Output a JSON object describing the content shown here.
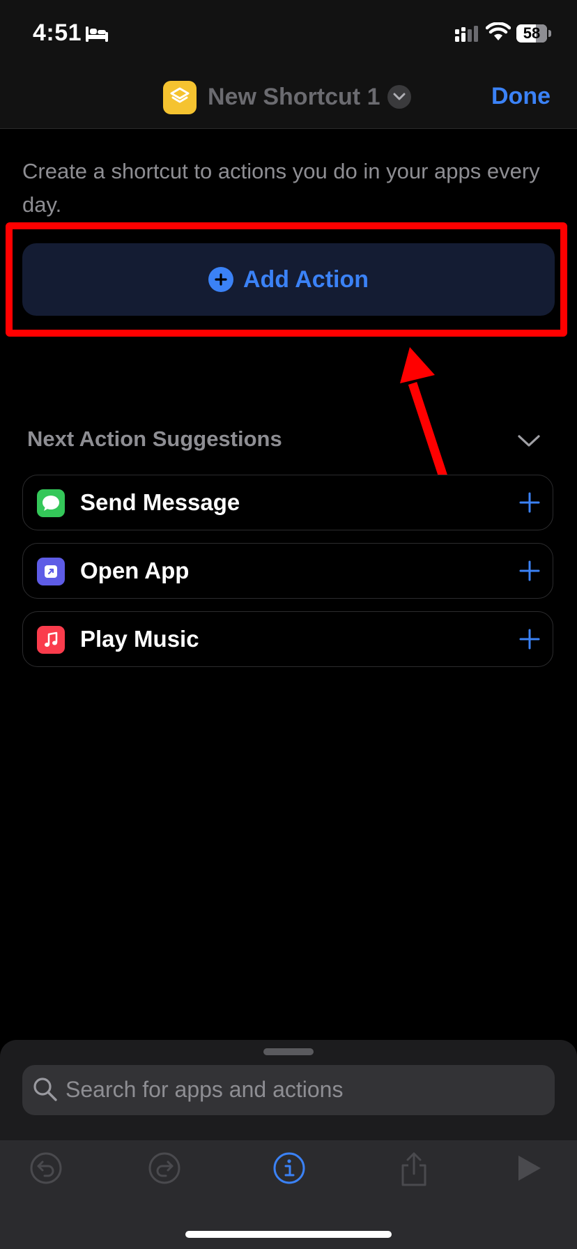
{
  "status": {
    "time": "4:51",
    "battery": "58"
  },
  "header": {
    "shortcut_name": "New Shortcut 1",
    "done_label": "Done"
  },
  "intro": "Create a shortcut to actions you do in your apps every day.",
  "add_action": {
    "label": "Add Action"
  },
  "suggestions": {
    "title": "Next Action Suggestions",
    "items": [
      {
        "label": "Send Message",
        "icon": "messages-icon",
        "color": "#34c759"
      },
      {
        "label": "Open App",
        "icon": "open-app-icon",
        "color": "#5e5ce6"
      },
      {
        "label": "Play Music",
        "icon": "music-icon",
        "color": "#fa3c4c"
      }
    ]
  },
  "search": {
    "placeholder": "Search for apps and actions"
  },
  "colors": {
    "accent": "#3b82f6",
    "highlight": "#ff0000"
  }
}
